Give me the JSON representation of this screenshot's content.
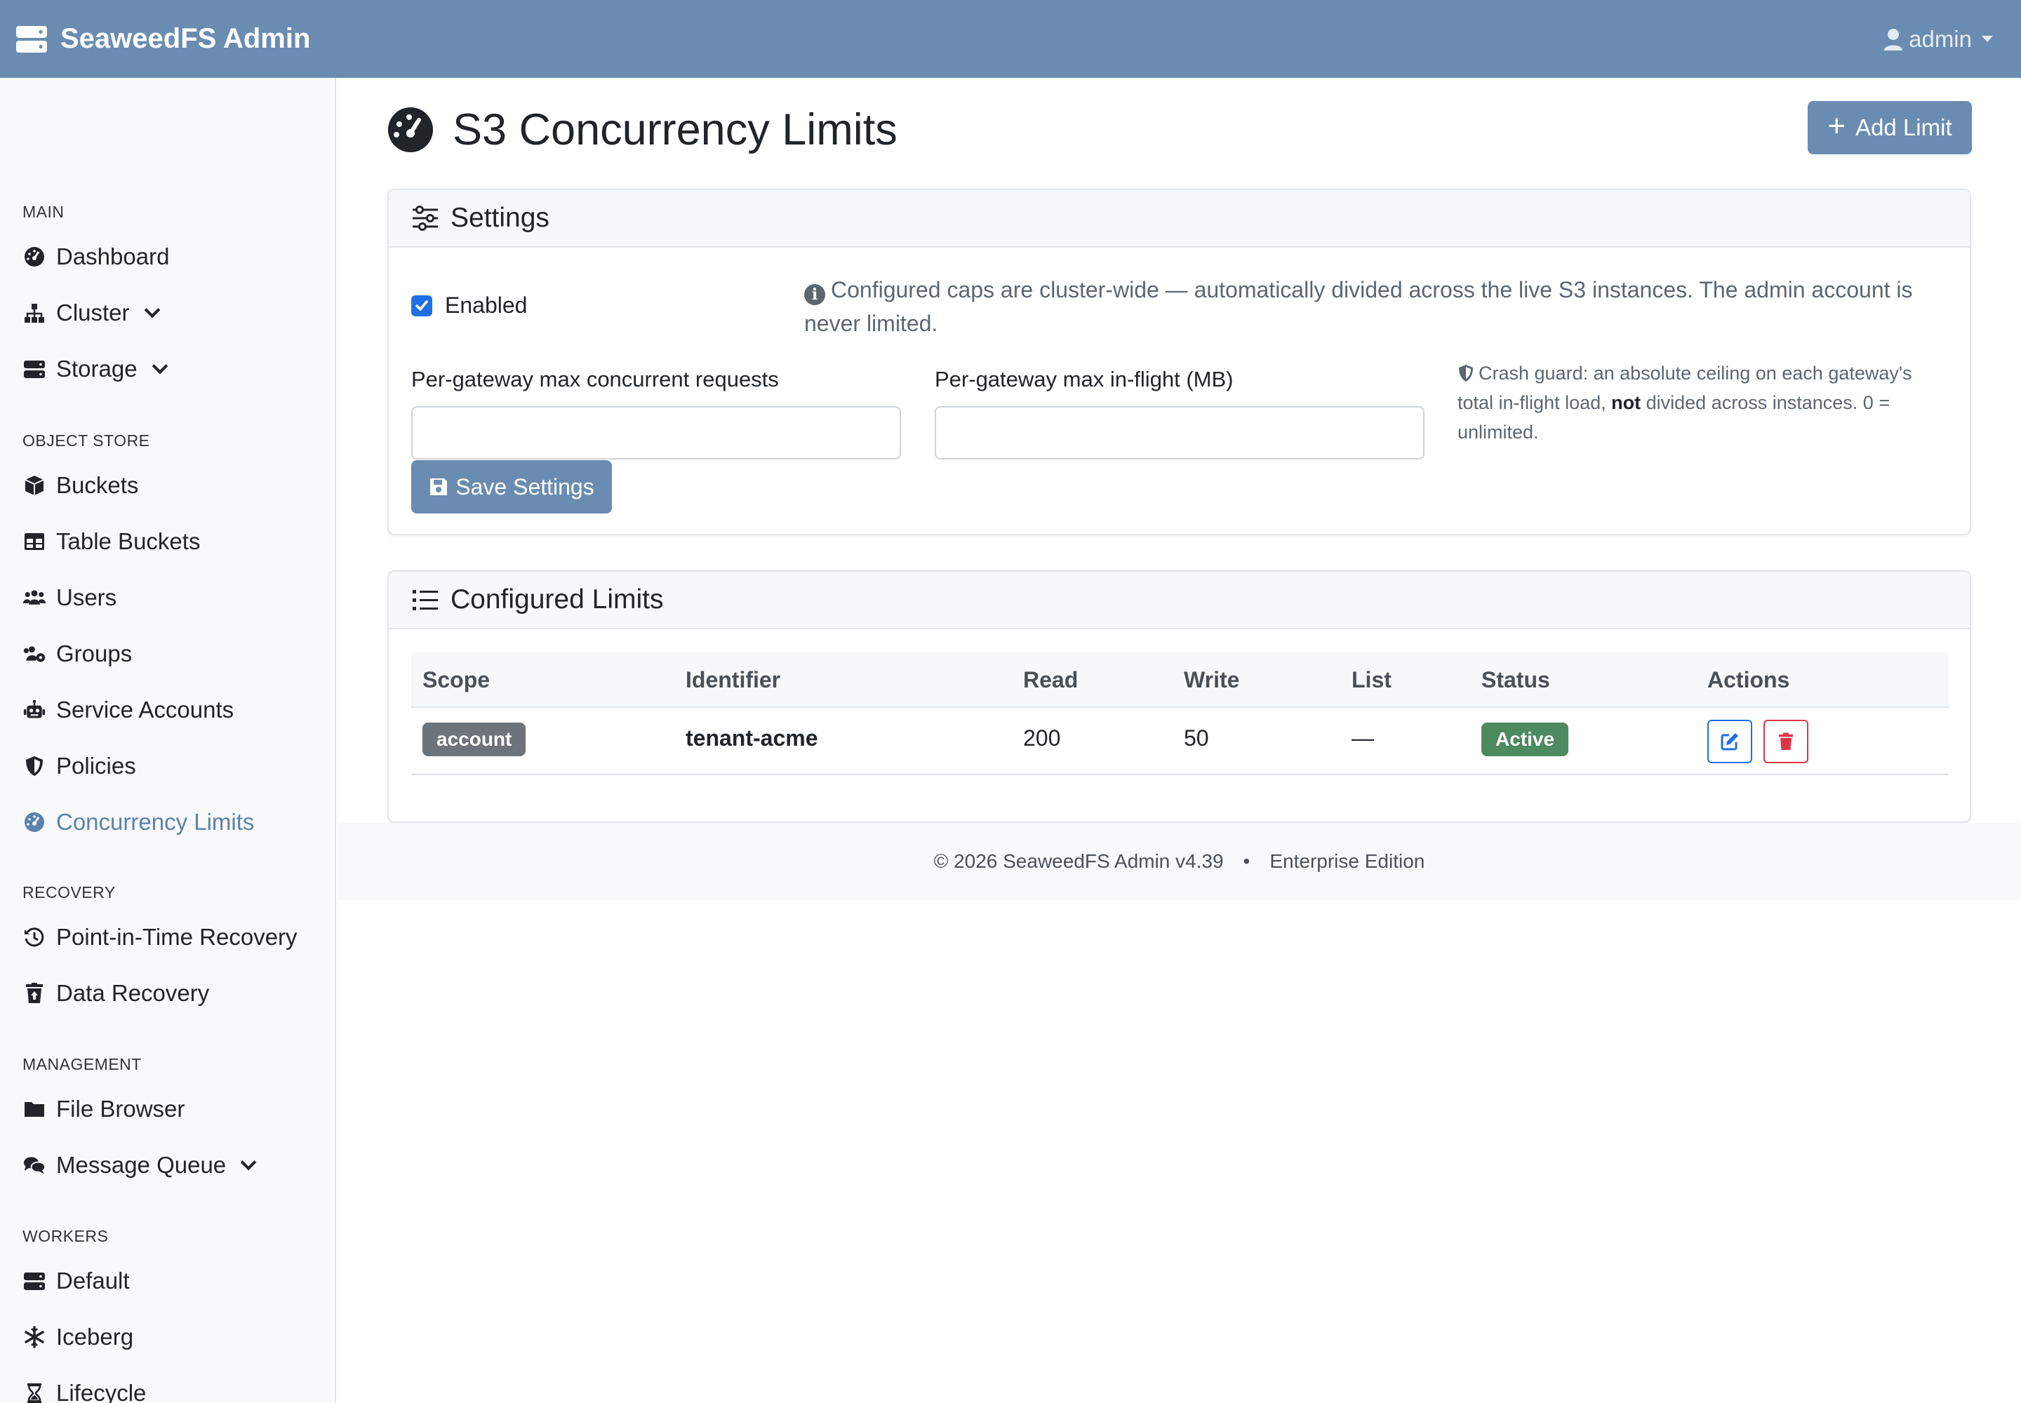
{
  "navbar": {
    "brand": "SeaweedFS Admin",
    "user": "admin"
  },
  "sidebar": {
    "sections": [
      {
        "heading": "MAIN",
        "items": [
          {
            "label": "Dashboard",
            "icon": "dashboard-icon"
          },
          {
            "label": "Cluster",
            "icon": "sitemap-icon",
            "expandable": true
          },
          {
            "label": "Storage",
            "icon": "server-icon",
            "expandable": true
          }
        ]
      },
      {
        "heading": "OBJECT STORE",
        "items": [
          {
            "label": "Buckets",
            "icon": "cube-icon"
          },
          {
            "label": "Table Buckets",
            "icon": "table-icon"
          },
          {
            "label": "Users",
            "icon": "users-icon"
          },
          {
            "label": "Groups",
            "icon": "users-cog-icon"
          },
          {
            "label": "Service Accounts",
            "icon": "robot-icon"
          },
          {
            "label": "Policies",
            "icon": "shield-icon"
          },
          {
            "label": "Concurrency Limits",
            "icon": "gauge-icon",
            "active": true
          }
        ]
      },
      {
        "heading": "RECOVERY",
        "items": [
          {
            "label": "Point-in-Time Recovery",
            "icon": "history-icon"
          },
          {
            "label": "Data Recovery",
            "icon": "trash-restore-icon"
          }
        ]
      },
      {
        "heading": "MANAGEMENT",
        "items": [
          {
            "label": "File Browser",
            "icon": "folder-icon"
          },
          {
            "label": "Message Queue",
            "icon": "comments-icon",
            "expandable": true
          }
        ]
      },
      {
        "heading": "WORKERS",
        "items": [
          {
            "label": "Default",
            "icon": "server-icon"
          },
          {
            "label": "Iceberg",
            "icon": "snowflake-icon"
          },
          {
            "label": "Lifecycle",
            "icon": "hourglass-icon"
          }
        ]
      }
    ]
  },
  "page": {
    "title": "S3 Concurrency Limits",
    "add_button": "Add Limit"
  },
  "settings": {
    "header": "Settings",
    "enabled_label": "Enabled",
    "enabled": true,
    "info": "Configured caps are cluster-wide — automatically divided across the live S3 instances. The admin account is never limited.",
    "max_requests_label": "Per-gateway max concurrent requests",
    "max_requests_value": "",
    "max_inflight_label": "Per-gateway max in-flight (MB)",
    "max_inflight_value": "",
    "guard_prefix": "Crash guard: an absolute ceiling on each gateway's total in-flight load,",
    "guard_bold": "not",
    "guard_suffix": "divided across instances. 0 = unlimited.",
    "save_button": "Save Settings"
  },
  "limits": {
    "header": "Configured Limits",
    "columns": [
      "Scope",
      "Identifier",
      "Read",
      "Write",
      "List",
      "Status",
      "Actions"
    ],
    "rows": [
      {
        "scope": "account",
        "identifier": "tenant-acme",
        "read": "200",
        "write": "50",
        "list": "—",
        "status": "Active"
      }
    ]
  },
  "footer": {
    "copyright": "© 2026 SeaweedFS Admin v4.39",
    "separator": "•",
    "edition": "Enterprise Edition"
  },
  "colors": {
    "navbar": "#6b8cb1",
    "active_nav": "#5b82ad",
    "status_active": "#4d8a5f",
    "scope_badge": "#6c737b",
    "edit": "#1f6fe5",
    "delete": "#dc3545"
  }
}
